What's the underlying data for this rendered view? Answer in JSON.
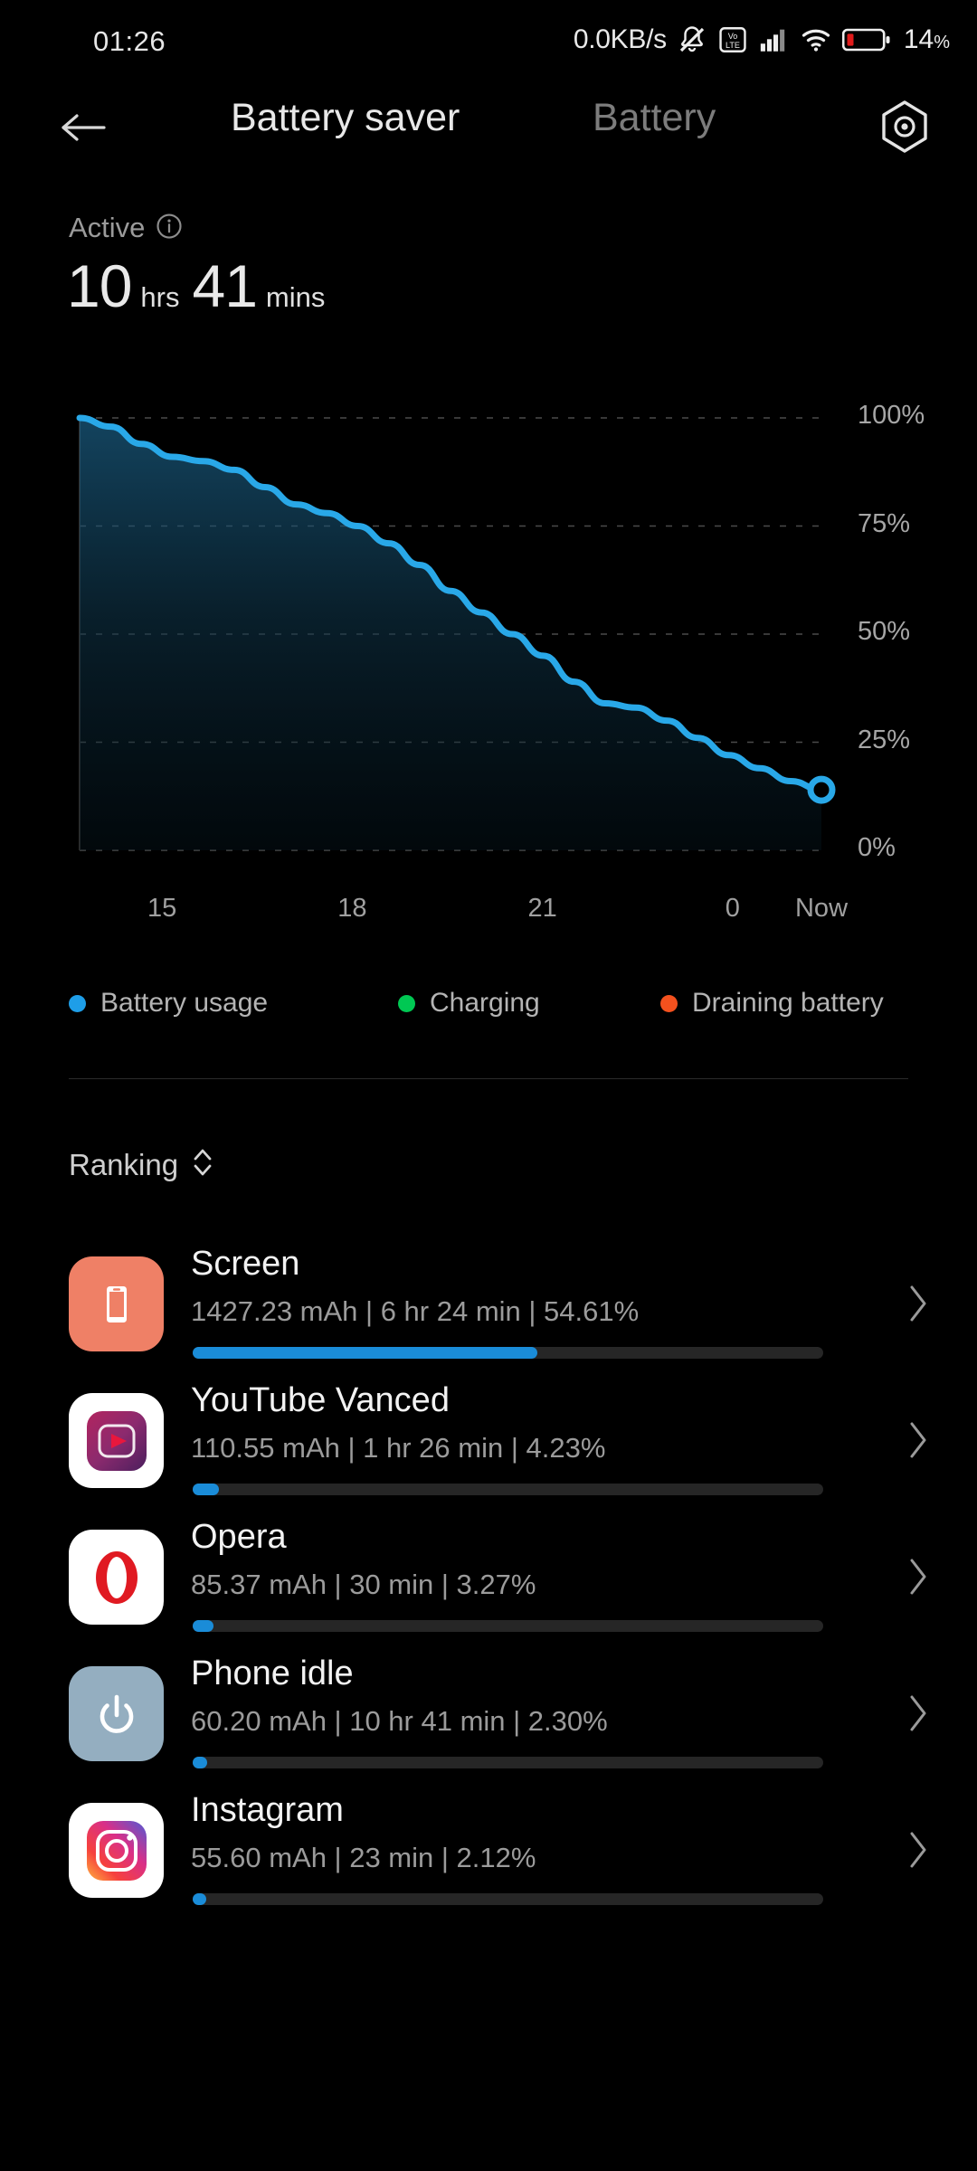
{
  "status_bar": {
    "time": "01:26",
    "network_speed": "0.0KB/s",
    "icons": [
      "bell-muted-icon",
      "volte-icon",
      "signal-bars-icon",
      "wifi-icon",
      "battery-icon"
    ],
    "volte_label": "Vo LTE",
    "battery_percent": "14",
    "battery_percent_symbol": "%"
  },
  "header": {
    "back_icon": "back-arrow-icon",
    "tab_active": "Battery saver",
    "tab_inactive": "Battery",
    "settings_icon": "settings-hexagon-icon"
  },
  "summary": {
    "status_label": "Active",
    "info_icon": "info-icon",
    "hours_value": "10",
    "hours_unit": "hrs",
    "mins_value": "41",
    "mins_unit": "mins"
  },
  "chart_data": {
    "type": "area",
    "title": "",
    "xlabel": "",
    "ylabel": "",
    "ylim": [
      0,
      100
    ],
    "grid": true,
    "y_ticks": [
      "100%",
      "75%",
      "50%",
      "25%",
      "0%"
    ],
    "y_tick_values": [
      100,
      75,
      50,
      25,
      0
    ],
    "x_ticks": [
      "15",
      "18",
      "21",
      "0",
      "Now"
    ],
    "x_tick_hours": [
      15,
      18,
      21,
      24,
      25.4
    ],
    "line_color": "#29a8e8",
    "endpoint_value": 14,
    "series": [
      {
        "name": "Battery usage",
        "x": [
          13.7,
          14.2,
          14.8,
          15.4,
          16.0,
          16.6,
          17.2,
          17.8,
          18.4,
          19.0,
          19.6,
          20.2,
          20.8,
          21.4,
          22.0,
          22.6,
          23.2,
          23.8,
          24.4,
          25.0,
          25.4
        ],
        "values": [
          100,
          98,
          94,
          91,
          90,
          88,
          84,
          80,
          78,
          75,
          71,
          66,
          60,
          55,
          50,
          45,
          39,
          34,
          33,
          30,
          26,
          22,
          19,
          16,
          14
        ]
      }
    ],
    "legend": [
      {
        "label": "Battery usage",
        "color": "#1e9ee8"
      },
      {
        "label": "Charging",
        "color": "#00c853"
      },
      {
        "label": "Draining battery",
        "color": "#f4511e"
      }
    ],
    "legend_position": "below"
  },
  "ranking": {
    "label": "Ranking",
    "sort_icon": "sort-updown-icon"
  },
  "apps": [
    {
      "name": "Screen",
      "icon": "screen-icon",
      "mah": "1427.23 mAh",
      "time": "6 hr 24 min",
      "percent": "54.61%",
      "detail": "1427.23 mAh | 6 hr 24 min  | 54.61%",
      "bar_percent": 54.61,
      "chevron_icon": "chevron-right-icon"
    },
    {
      "name": "YouTube Vanced",
      "icon": "youtube-vanced-icon",
      "mah": "110.55 mAh",
      "time": "1 hr 26 min",
      "percent": "4.23%",
      "detail": "110.55 mAh | 1 hr 26 min  | 4.23%",
      "bar_percent": 4.23,
      "chevron_icon": "chevron-right-icon"
    },
    {
      "name": "Opera",
      "icon": "opera-icon",
      "mah": "85.37 mAh",
      "time": "30 min",
      "percent": "3.27%",
      "detail": "85.37 mAh | 30 min  | 3.27%",
      "bar_percent": 3.27,
      "chevron_icon": "chevron-right-icon"
    },
    {
      "name": "Phone idle",
      "icon": "phone-idle-icon",
      "mah": "60.20 mAh",
      "time": "10 hr 41 min",
      "percent": "2.30%",
      "detail": "60.20 mAh | 10 hr 41 min  | 2.30%",
      "bar_percent": 2.3,
      "chevron_icon": "chevron-right-icon"
    },
    {
      "name": "Instagram",
      "icon": "instagram-icon",
      "mah": "55.60 mAh",
      "time": "23 min",
      "percent": "2.12%",
      "detail": "55.60 mAh | 23 min  | 2.12%",
      "bar_percent": 2.12,
      "chevron_icon": "chevron-right-icon"
    }
  ]
}
